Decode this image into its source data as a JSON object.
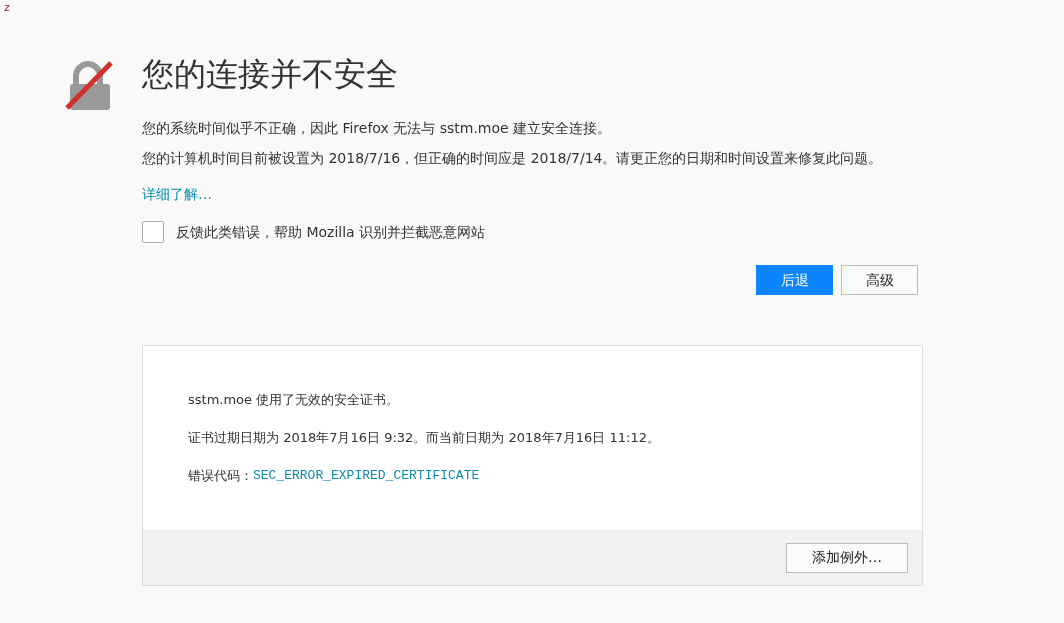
{
  "corner_mark": "z",
  "title": "您的连接并不安全",
  "paragraphs": [
    "您的系统时间似乎不正确，因此 Firefox 无法与 sstm.moe 建立安全连接。",
    "您的计算机时间目前被设置为 2018/7/16，但正确的时间应是 2018/7/14。请更正您的日期和时间设置来修复此问题。"
  ],
  "learn_more_link": "详细了解…",
  "report_checkbox": {
    "label": "反馈此类错误，帮助 Mozilla 识别并拦截恶意网站",
    "checked": false
  },
  "buttons": [
    {
      "label": "后退",
      "kind": "primary"
    },
    {
      "label": "高级",
      "kind": "secondary"
    }
  ],
  "advanced_panel": {
    "lines": [
      "sstm.moe 使用了无效的安全证书。",
      "证书过期日期为 2018年7月16日 9:32。而当前日期为 2018年7月16日 11:12。"
    ],
    "error_code_label": "错误代码：",
    "error_code": "SEC_ERROR_EXPIRED_CERTIFICATE",
    "add_exception_button": "添加例外…"
  }
}
